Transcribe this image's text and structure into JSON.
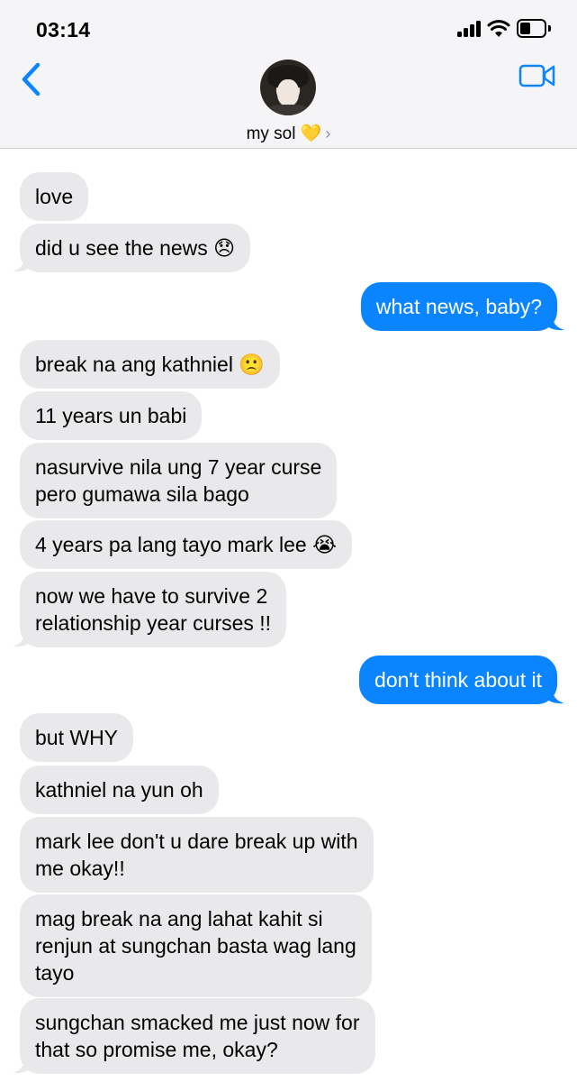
{
  "status_bar": {
    "time": "03:14",
    "signal_icon": "signal-icon",
    "wifi_icon": "wifi-icon",
    "battery_icon": "battery-icon"
  },
  "header": {
    "back_icon": "chevron-left-icon",
    "video_icon": "video-camera-icon",
    "contact_name": "my sol 💛",
    "contact_chevron": "›",
    "accent_color": "#0a84ff"
  },
  "messages": [
    {
      "side": "in",
      "text": "love"
    },
    {
      "side": "in",
      "text": "did u see the news 😞"
    },
    {
      "side": "out",
      "text": "what news, baby?"
    },
    {
      "side": "in",
      "text": "break na ang kathniel 🙁"
    },
    {
      "side": "in",
      "text": "11 years un babi"
    },
    {
      "side": "in",
      "lines": [
        "nasurvive nila ung 7 year curse",
        "pero gumawa sila bago"
      ]
    },
    {
      "side": "in",
      "text": "4 years pa lang tayo mark lee 😭"
    },
    {
      "side": "in",
      "lines": [
        "now we have to survive 2",
        "relationship year curses !!"
      ]
    },
    {
      "side": "out",
      "text": "don't think about it"
    },
    {
      "side": "in",
      "text": "but WHY"
    },
    {
      "side": "in",
      "text": "kathniel na yun oh"
    },
    {
      "side": "in",
      "lines": [
        "mark lee don't u dare break up with",
        "me okay!!"
      ]
    },
    {
      "side": "in",
      "lines": [
        "mag break na ang lahat kahit si",
        "renjun at sungchan basta wag lang",
        "tayo"
      ]
    },
    {
      "side": "in",
      "lines": [
        "sungchan smacked me just now for",
        "that so promise me, okay?"
      ]
    }
  ]
}
